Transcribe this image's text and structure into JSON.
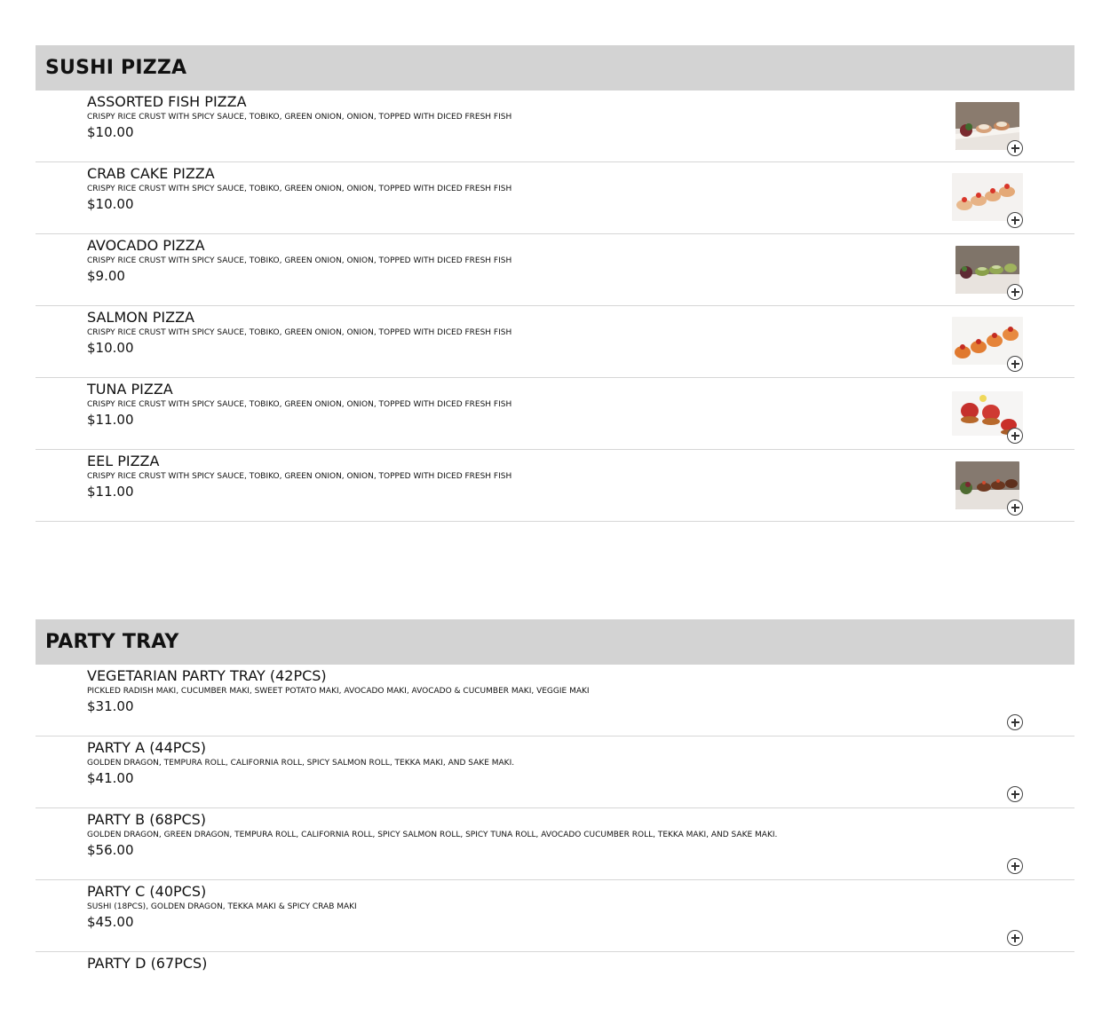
{
  "sections": [
    {
      "title": "SUSHI PIZZA",
      "items": [
        {
          "name": "ASSORTED FISH PIZZA",
          "desc": "CRISPY RICE CRUST WITH SPICY SAUCE, TOBIKO, GREEN ONION, ONION, TOPPED WITH DICED FRESH FISH",
          "price": "$10.00"
        },
        {
          "name": "CRAB CAKE PIZZA",
          "desc": "CRISPY RICE CRUST WITH SPICY SAUCE, TOBIKO, GREEN ONION, ONION, TOPPED WITH DICED FRESH FISH",
          "price": "$10.00"
        },
        {
          "name": "AVOCADO PIZZA",
          "desc": "CRISPY RICE CRUST WITH SPICY SAUCE, TOBIKO, GREEN ONION, ONION, TOPPED WITH DICED FRESH FISH",
          "price": "$9.00"
        },
        {
          "name": "SALMON PIZZA",
          "desc": "CRISPY RICE CRUST WITH SPICY SAUCE, TOBIKO, GREEN ONION, ONION, TOPPED WITH DICED FRESH FISH",
          "price": "$10.00"
        },
        {
          "name": "TUNA PIZZA",
          "desc": "CRISPY RICE CRUST WITH SPICY SAUCE, TOBIKO, GREEN ONION, ONION, TOPPED WITH DICED FRESH FISH",
          "price": "$11.00"
        },
        {
          "name": "EEL PIZZA",
          "desc": "CRISPY RICE CRUST WITH SPICY SAUCE, TOBIKO, GREEN ONION, ONION, TOPPED WITH DICED FRESH FISH",
          "price": "$11.00"
        }
      ]
    },
    {
      "title": "PARTY TRAY",
      "items": [
        {
          "name": "VEGETARIAN PARTY TRAY (42PCS)",
          "desc": "PICKLED RADISH MAKI, CUCUMBER MAKI, SWEET POTATO MAKI, AVOCADO MAKI, AVOCADO & CUCUMBER MAKI, VEGGIE MAKI",
          "price": "$31.00"
        },
        {
          "name": "PARTY A (44PCS)",
          "desc": "GOLDEN DRAGON, TEMPURA ROLL, CALIFORNIA ROLL, SPICY SALMON ROLL, TEKKA MAKI, AND SAKE MAKI.",
          "price": "$41.00"
        },
        {
          "name": "PARTY B (68PCS)",
          "desc": "GOLDEN DRAGON, GREEN DRAGON, TEMPURA ROLL, CALIFORNIA ROLL, SPICY SALMON ROLL, SPICY TUNA ROLL, AVOCADO CUCUMBER ROLL, TEKKA MAKI, AND SAKE MAKI.",
          "price": "$56.00"
        },
        {
          "name": "PARTY C (40PCS)",
          "desc": "SUSHI (18PCS), GOLDEN DRAGON, TEKKA MAKI & SPICY CRAB MAKI",
          "price": "$45.00"
        },
        {
          "name": "PARTY D (67PCS)",
          "desc": "",
          "price": ""
        }
      ]
    }
  ]
}
